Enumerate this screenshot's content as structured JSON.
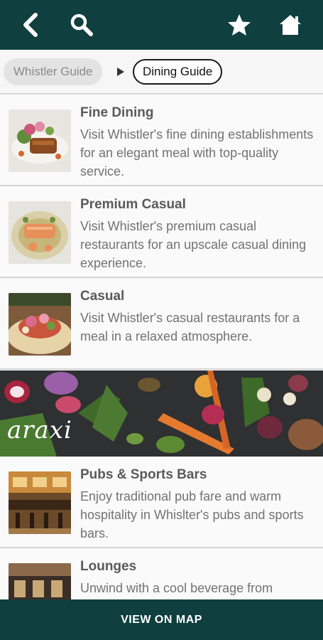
{
  "toolbar": {
    "back_icon": "chevron-left-icon",
    "search_icon": "search-icon",
    "favorite_icon": "star-icon",
    "home_icon": "home-icon"
  },
  "breadcrumb": {
    "parent": "Whistler Guide",
    "current": "Dining Guide"
  },
  "items": [
    {
      "title": "Fine Dining",
      "description": "Visit Whistler's fine dining establishments for an elegant meal with top-quality service."
    },
    {
      "title": "Premium Casual",
      "description": "Visit Whistler's premium casual restaurants for an upscale casual dining experience."
    },
    {
      "title": "Casual",
      "description": "Visit Whistler's casual restaurants for a meal in a relaxed atmosphere."
    },
    {
      "title": "Pubs & Sports Bars",
      "description": "Enjoy traditional pub fare and warm hospitality in Whislter's pubs and sports bars."
    },
    {
      "title": "Lounges",
      "description": "Unwind with a cool beverage from"
    }
  ],
  "banner": {
    "logo": "araxi"
  },
  "footer": {
    "map_button": "VIEW ON MAP"
  },
  "colors": {
    "header": "#0f3f3f",
    "divider": "#d4d4d4"
  }
}
